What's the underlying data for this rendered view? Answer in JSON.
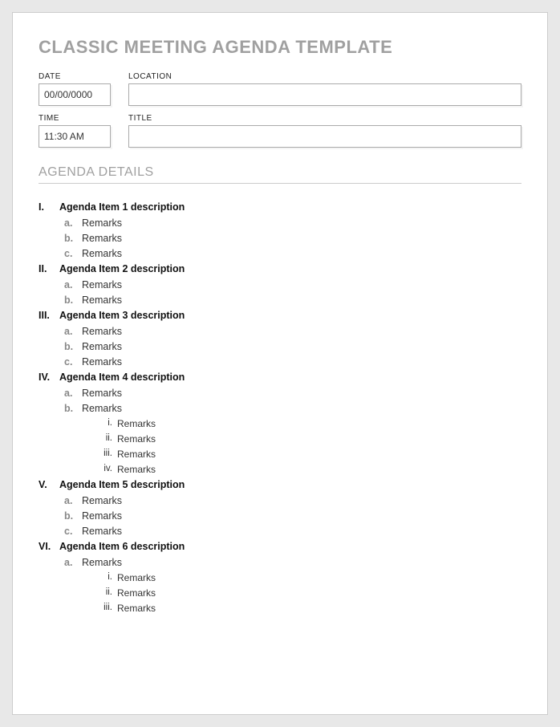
{
  "title": "CLASSIC MEETING AGENDA TEMPLATE",
  "form": {
    "date_label": "DATE",
    "date_value": "00/00/0000",
    "location_label": "LOCATION",
    "location_value": "",
    "time_label": "TIME",
    "time_value": "11:30 AM",
    "title_label": "TITLE",
    "title_value": ""
  },
  "section_header": "AGENDA DETAILS",
  "agenda": [
    {
      "roman": "I.",
      "title": "Agenda Item 1 description",
      "subs": [
        {
          "letter": "a.",
          "text": "Remarks",
          "children": []
        },
        {
          "letter": "b.",
          "text": "Remarks",
          "children": []
        },
        {
          "letter": "c.",
          "text": "Remarks",
          "children": []
        }
      ]
    },
    {
      "roman": "II.",
      "title": "Agenda Item 2 description",
      "subs": [
        {
          "letter": "a.",
          "text": "Remarks",
          "children": []
        },
        {
          "letter": "b.",
          "text": "Remarks",
          "children": []
        }
      ]
    },
    {
      "roman": "III.",
      "title": "Agenda Item 3 description",
      "subs": [
        {
          "letter": "a.",
          "text": "Remarks",
          "children": []
        },
        {
          "letter": "b.",
          "text": "Remarks",
          "children": []
        },
        {
          "letter": "c.",
          "text": "Remarks",
          "children": []
        }
      ]
    },
    {
      "roman": "IV.",
      "title": "Agenda Item 4 description",
      "subs": [
        {
          "letter": "a.",
          "text": "Remarks",
          "children": []
        },
        {
          "letter": "b.",
          "text": "Remarks",
          "children": [
            {
              "roman": "i.",
              "text": "Remarks"
            },
            {
              "roman": "ii.",
              "text": "Remarks"
            },
            {
              "roman": "iii.",
              "text": "Remarks"
            },
            {
              "roman": "iv.",
              "text": "Remarks"
            }
          ]
        }
      ]
    },
    {
      "roman": "V.",
      "title": "Agenda Item 5 description",
      "subs": [
        {
          "letter": "a.",
          "text": "Remarks",
          "children": []
        },
        {
          "letter": "b.",
          "text": "Remarks",
          "children": []
        },
        {
          "letter": "c.",
          "text": "Remarks",
          "children": []
        }
      ]
    },
    {
      "roman": "VI.",
      "title": "Agenda Item 6 description",
      "subs": [
        {
          "letter": "a.",
          "text": "Remarks",
          "children": [
            {
              "roman": "i.",
              "text": "Remarks"
            },
            {
              "roman": "ii.",
              "text": "Remarks"
            },
            {
              "roman": "iii.",
              "text": "Remarks"
            }
          ]
        }
      ]
    }
  ]
}
